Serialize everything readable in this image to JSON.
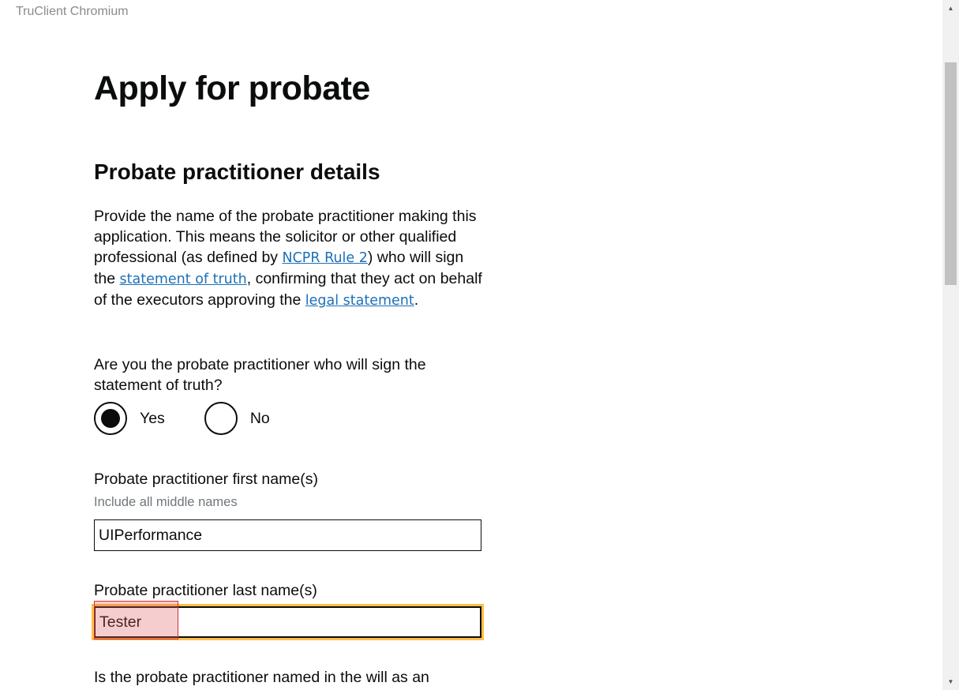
{
  "app": {
    "title": "TruClient Chromium"
  },
  "page": {
    "title": "Apply for probate",
    "section_title": "Probate practitioner details",
    "intro": {
      "part1": "Provide the name of the probate practitioner making this application. This means the solicitor or other qualified professional (as defined by ",
      "link_ncpr": "NCPR Rule 2",
      "part2": ") who will sign the ",
      "link_statement_of_truth": "statement of truth",
      "part3": ", confirming that they act on behalf of the executors approving the ",
      "link_legal_statement": "legal statement",
      "part4": "."
    }
  },
  "form": {
    "sign_question": "Are you the probate practitioner who will sign the statement of truth?",
    "options": {
      "yes": "Yes",
      "no": "No"
    },
    "selected_option": "Yes",
    "first_name": {
      "label": "Probate practitioner first name(s)",
      "hint": "Include all middle names",
      "value": "UIPerformance"
    },
    "last_name": {
      "label": "Probate practitioner last name(s)",
      "value": "Tester"
    },
    "next_question": "Is the probate practitioner named in the will as an"
  },
  "colors": {
    "link": "#1d70b8",
    "focus": "#ffbf47",
    "text": "#0b0c0c",
    "hint": "#6f777b",
    "highlight": "#e15a5f"
  }
}
